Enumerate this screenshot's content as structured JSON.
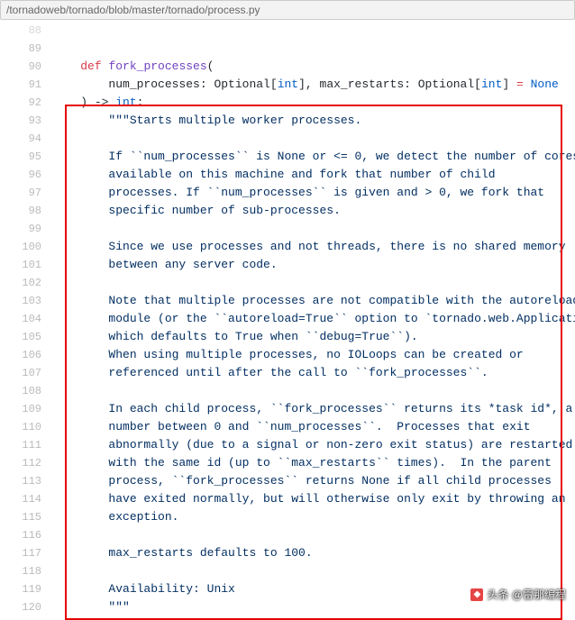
{
  "breadcrumb": "/tornadoweb/tornado/blob/master/tornado/process.py",
  "watermark": "头条 @雷那编程",
  "code": {
    "indent1": "    ",
    "indent2": "        ",
    "def": "def",
    "fn_name": "fork_processes",
    "param_open": "(",
    "p1_name": "num_processes",
    "colon": ": ",
    "optional": "Optional",
    "lb": "[",
    "int": "int",
    "rb": "]",
    "comma": ", ",
    "p2_name": "max_restarts",
    "eq": " = ",
    "none": "None",
    "sig_close": ") -> ",
    "ret_colon": ":",
    "doc": {
      "open": "\"\"\"Starts multiple worker processes.",
      "l95": "If ``num_processes`` is None or <= 0, we detect the number of cores",
      "l96": "available on this machine and fork that number of child",
      "l97": "processes. If ``num_processes`` is given and > 0, we fork that",
      "l98": "specific number of sub-processes.",
      "l100": "Since we use processes and not threads, there is no shared memory",
      "l101": "between any server code.",
      "l103": "Note that multiple processes are not compatible with the autoreload",
      "l104": "module (or the ``autoreload=True`` option to `tornado.web.Application`",
      "l105": "which defaults to True when ``debug=True``).",
      "l106": "When using multiple processes, no IOLoops can be created or",
      "l107": "referenced until after the call to ``fork_processes``.",
      "l109": "In each child process, ``fork_processes`` returns its *task id*, a",
      "l110": "number between 0 and ``num_processes``.  Processes that exit",
      "l111": "abnormally (due to a signal or non-zero exit status) are restarted",
      "l112": "with the same id (up to ``max_restarts`` times).  In the parent",
      "l113": "process, ``fork_processes`` returns None if all child processes",
      "l114": "have exited normally, but will otherwise only exit by throwing an",
      "l115": "exception.",
      "l117": "max_restarts defaults to 100.",
      "l119": "Availability: Unix",
      "close": "\"\"\""
    }
  },
  "gutters": {
    "g88": "88",
    "g89": "89",
    "g90": "90",
    "g91": "91",
    "g92": "92",
    "g93": "93",
    "g94": "94",
    "g95": "95",
    "g96": "96",
    "g97": "97",
    "g98": "98",
    "g99": "99",
    "g100": "100",
    "g101": "101",
    "g102": "102",
    "g103": "103",
    "g104": "104",
    "g105": "105",
    "g106": "106",
    "g107": "107",
    "g108": "108",
    "g109": "109",
    "g110": "110",
    "g111": "111",
    "g112": "112",
    "g113": "113",
    "g114": "114",
    "g115": "115",
    "g116": "116",
    "g117": "117",
    "g118": "118",
    "g119": "119",
    "g120": "120"
  }
}
